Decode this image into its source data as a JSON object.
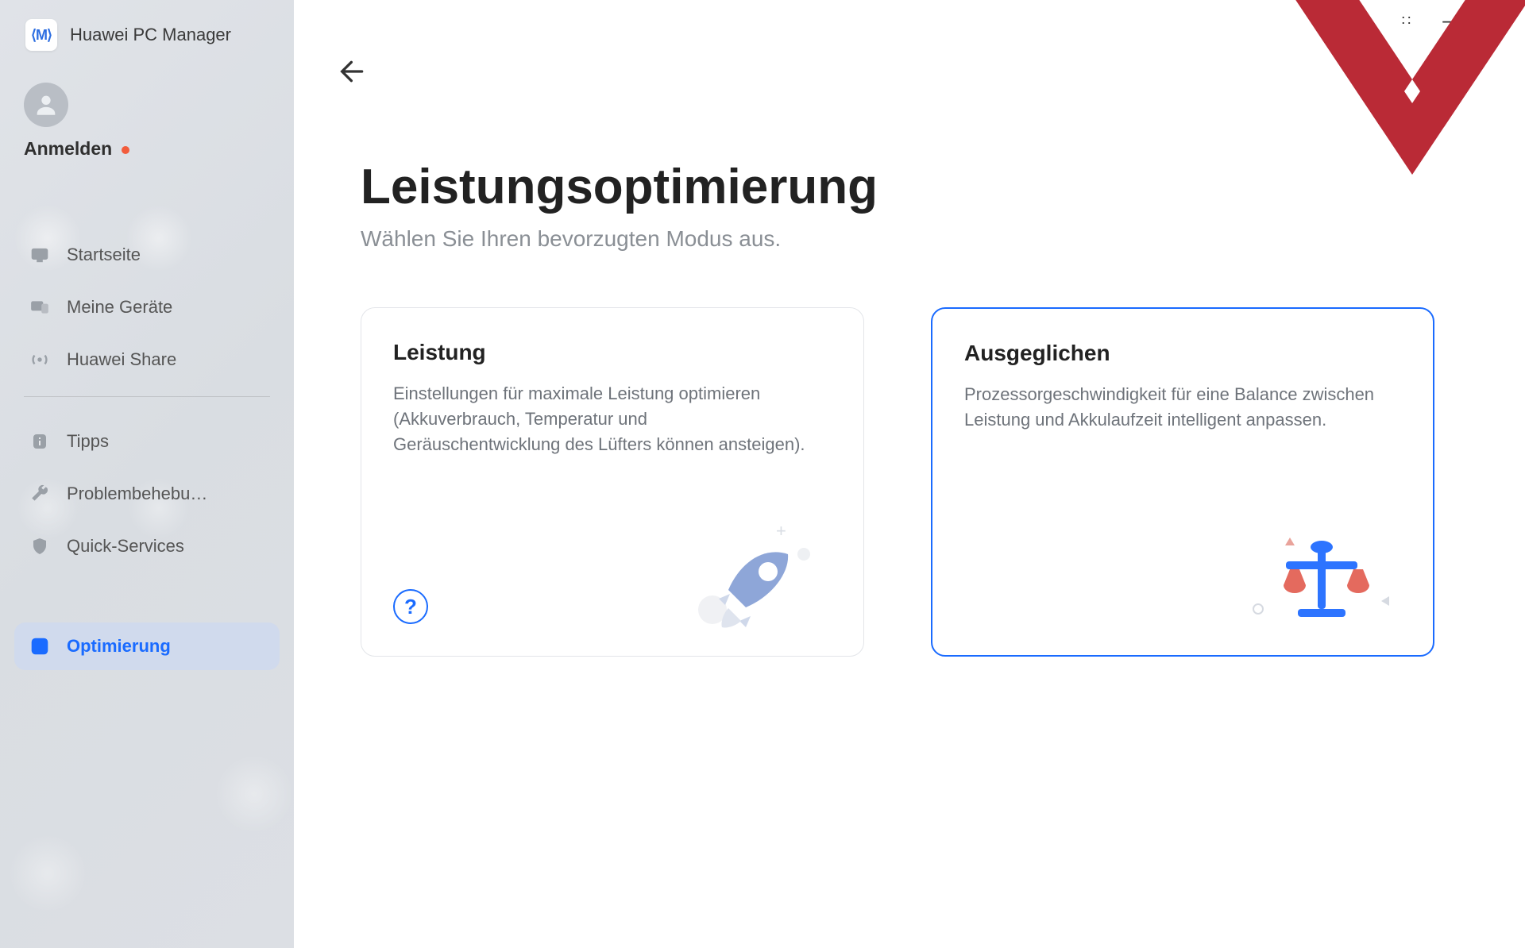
{
  "app": {
    "title": "Huawei PC Manager",
    "logo_text": "⟨M⟩"
  },
  "user": {
    "login_label": "Anmelden",
    "status_indicator": true
  },
  "sidebar": {
    "items": [
      {
        "id": "home",
        "label": "Startseite",
        "icon": "monitor-icon"
      },
      {
        "id": "devices",
        "label": "Meine Geräte",
        "icon": "devices-icon"
      },
      {
        "id": "share",
        "label": "Huawei Share",
        "icon": "broadcast-icon"
      }
    ],
    "items2": [
      {
        "id": "tips",
        "label": "Tipps",
        "icon": "info-icon"
      },
      {
        "id": "trouble",
        "label": "Problembehebu…",
        "icon": "wrench-icon"
      },
      {
        "id": "quick",
        "label": "Quick-Services",
        "icon": "shield-icon"
      }
    ],
    "active": {
      "id": "optim",
      "label": "Optimierung",
      "icon": "upload-icon"
    }
  },
  "page": {
    "title": "Leistungsoptimierung",
    "subtitle": "Wählen Sie Ihren bevorzugten Modus aus."
  },
  "cards": {
    "performance": {
      "title": "Leistung",
      "desc": "Einstellungen für maximale Leistung optimieren (Akkuverbrauch, Temperatur und Geräuschentwicklung des Lüfters können ansteigen).",
      "help": "?"
    },
    "balanced": {
      "title": "Ausgeglichen",
      "desc": "Prozessorgeschwindigkeit für eine Balance zwischen Leistung und Akkulaufzeit intelligent anpassen."
    }
  },
  "window_controls": {
    "more": "∷",
    "minimize": "—",
    "close": "✕"
  }
}
